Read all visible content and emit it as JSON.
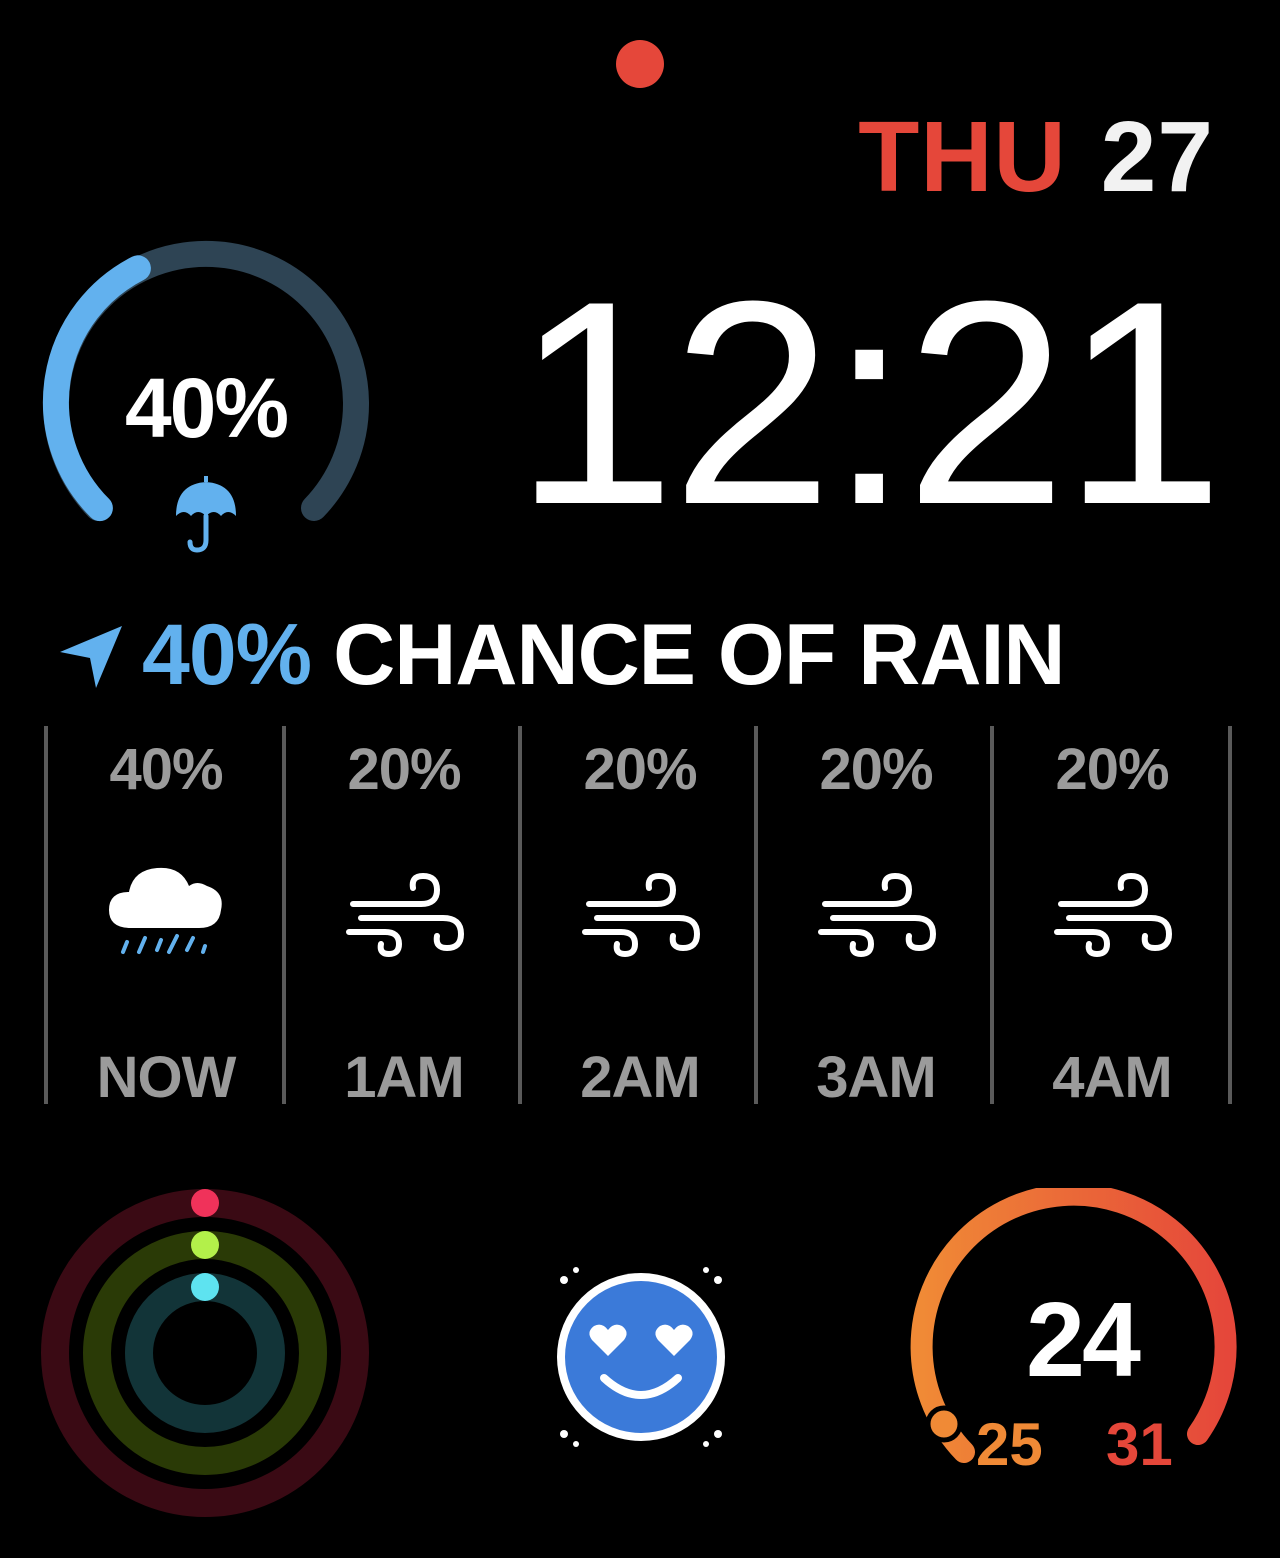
{
  "colors": {
    "red": "#e5473a",
    "blue": "#62b1ee",
    "blue_dark": "#2e4454",
    "orange": "#f08a36",
    "gray": "#9b9b9b",
    "emoji_blue": "#3b7ad9"
  },
  "date": {
    "weekday": "THU",
    "day": "27"
  },
  "time": "12:21",
  "rain_gauge": {
    "value": "40%",
    "fraction": 0.4,
    "icon": "umbrella-icon"
  },
  "headline": {
    "icon": "location-arrow-icon",
    "percent": "40%",
    "text": "CHANCE OF RAIN"
  },
  "forecast": [
    {
      "pct": "40%",
      "icon": "rain-cloud-icon",
      "time": "NOW"
    },
    {
      "pct": "20%",
      "icon": "wind-icon",
      "time": "1AM"
    },
    {
      "pct": "20%",
      "icon": "wind-icon",
      "time": "2AM"
    },
    {
      "pct": "20%",
      "icon": "wind-icon",
      "time": "3AM"
    },
    {
      "pct": "20%",
      "icon": "wind-icon",
      "time": "4AM"
    }
  ],
  "activity": {
    "icon": "activity-rings-icon",
    "move": 0.0,
    "exercise": 0.0,
    "stand": 0.0
  },
  "emoji": {
    "icon": "heart-eyes-emoji-icon"
  },
  "temperature": {
    "current": "24",
    "low": "25",
    "high": "31"
  }
}
